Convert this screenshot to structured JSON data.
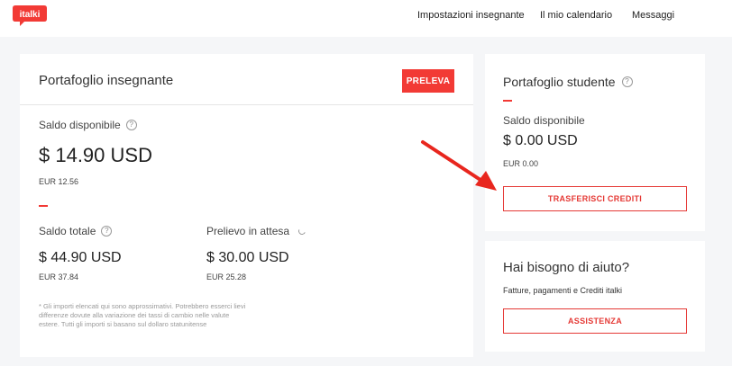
{
  "brand": {
    "logo_text": "italki",
    "color": "#f23a35"
  },
  "nav": {
    "items": [
      "Impostazioni insegnante",
      "Il mio calendario",
      "Messaggi"
    ]
  },
  "teacher_wallet": {
    "title": "Portafoglio insegnante",
    "withdraw_label": "PRELEVA",
    "available": {
      "label": "Saldo disponibile",
      "usd": "$ 14.90 USD",
      "eur": "EUR 12.56"
    },
    "total": {
      "label": "Saldo totale",
      "usd": "$ 44.90 USD",
      "eur": "EUR 37.84"
    },
    "pending": {
      "label": "Prelievo in attesa",
      "usd": "$ 30.00 USD",
      "eur": "EUR 25.28"
    },
    "note": "* Gli importi elencati qui sono approssimativi. Potrebbero esserci lievi differenze dovute alla variazione dei tassi di cambio nelle valute estere. Tutti gli importi si basano sul dollaro statunitense"
  },
  "student_wallet": {
    "title": "Portafoglio studente",
    "available_label": "Saldo disponibile",
    "usd": "$ 0.00 USD",
    "eur": "EUR 0.00",
    "transfer_label": "TRASFERISCI CREDITI"
  },
  "help": {
    "title": "Hai bisogno di aiuto?",
    "subtitle": "Fatture, pagamenti e Crediti italki",
    "button_label": "ASSISTENZA"
  },
  "icons": {
    "help": "question-circle-icon",
    "pending": "spinner-icon",
    "annotation": "red-arrow-icon"
  }
}
